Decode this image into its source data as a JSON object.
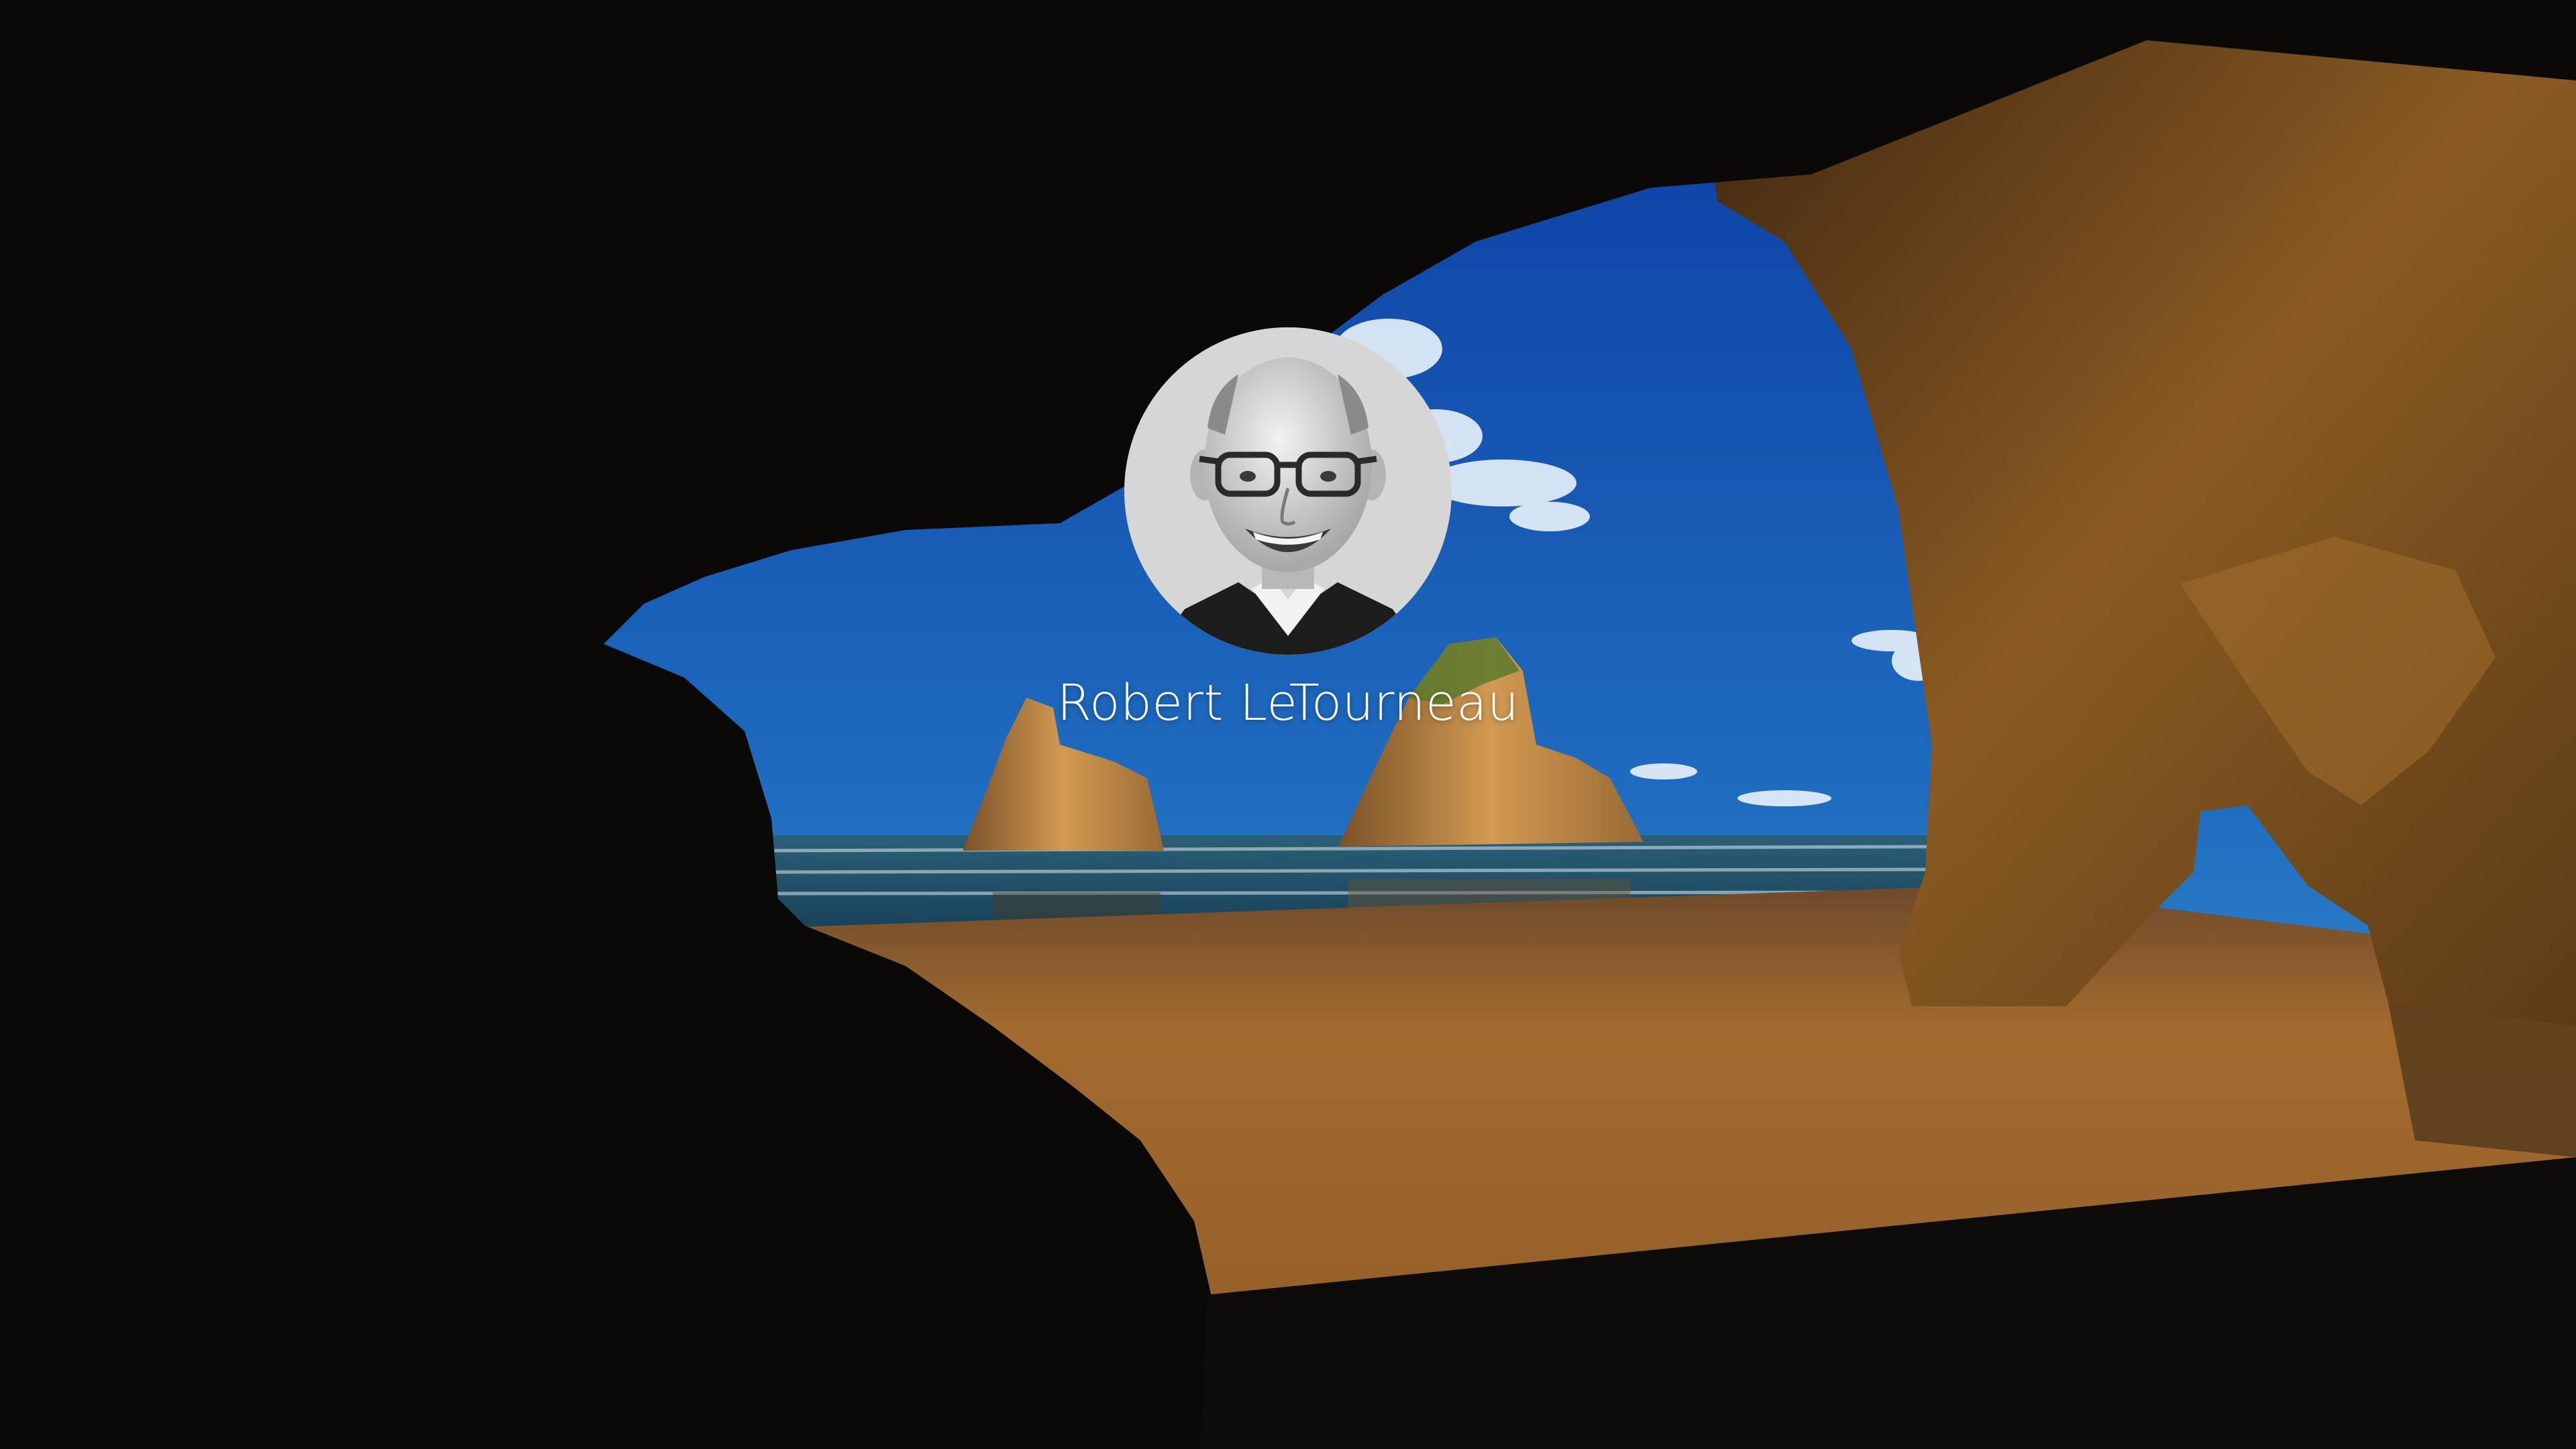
{
  "screen": "windows-lock-screen",
  "user": {
    "name": "Robert LeTourneau",
    "avatar_icon": "user-avatar-photo"
  },
  "wallpaper": {
    "scene": "sea-cave-beach",
    "colors": {
      "sky_top": "#0a3fa6",
      "sky_bottom": "#3f9bd0",
      "sea": "#1c4c66",
      "sand": "#a06a2c",
      "rock": "#6b4418",
      "cave": "#0a0908"
    }
  }
}
